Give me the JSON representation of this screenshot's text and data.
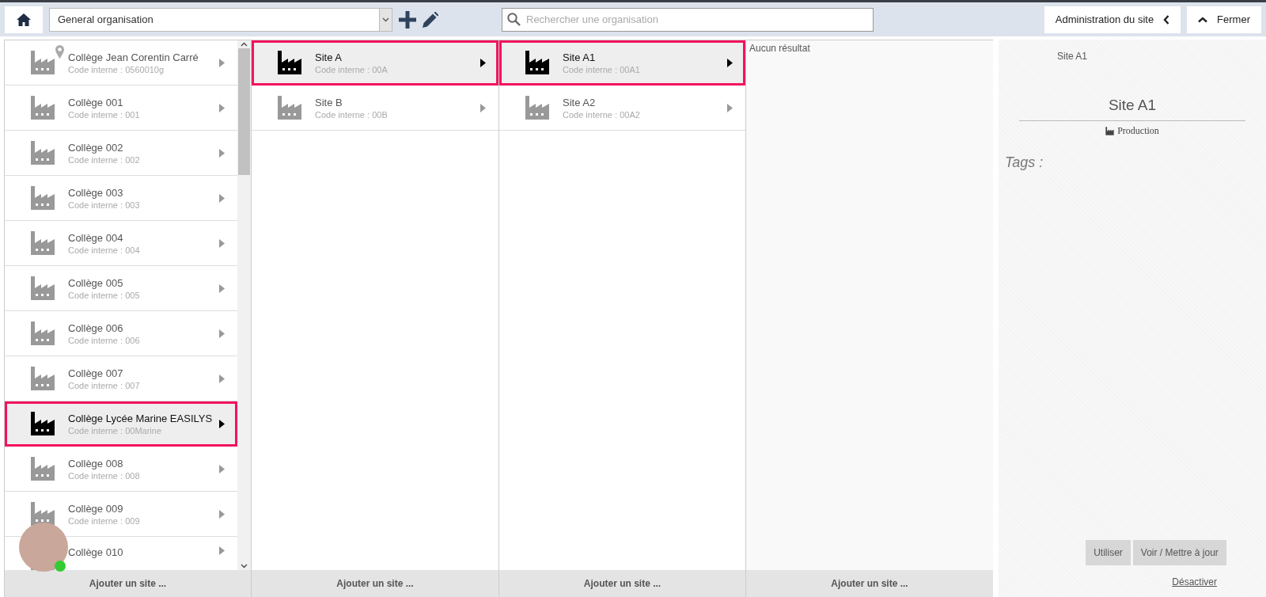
{
  "toolbar": {
    "organisation": "General organisation",
    "search_placeholder": "Rechercher une organisation",
    "admin_button": "Administration du site",
    "close_button": "Fermer"
  },
  "columns": [
    {
      "footer": "Ajouter un site ...",
      "items": [
        {
          "name": "Collège Jean Corentin Carré",
          "code": "Code interne : 0560010g",
          "selected": false,
          "pinned": true
        },
        {
          "name": "Collège 001",
          "code": "Code interne : 001",
          "selected": false,
          "pinned": false
        },
        {
          "name": "Collège 002",
          "code": "Code interne : 002",
          "selected": false,
          "pinned": false
        },
        {
          "name": "Collège 003",
          "code": "Code interne : 003",
          "selected": false,
          "pinned": false
        },
        {
          "name": "Collège 004",
          "code": "Code interne : 004",
          "selected": false,
          "pinned": false
        },
        {
          "name": "Collège 005",
          "code": "Code interne : 005",
          "selected": false,
          "pinned": false
        },
        {
          "name": "Collège 006",
          "code": "Code interne : 006",
          "selected": false,
          "pinned": false
        },
        {
          "name": "Collège 007",
          "code": "Code interne : 007",
          "selected": false,
          "pinned": false
        },
        {
          "name": "Collège Lycée Marine EASILYS",
          "code": "Code interne : 00Marine",
          "selected": true,
          "pinned": false
        },
        {
          "name": "Collège 008",
          "code": "Code interne : 008",
          "selected": false,
          "pinned": false
        },
        {
          "name": "Collège 009",
          "code": "Code interne : 009",
          "selected": false,
          "pinned": false
        },
        {
          "name": "Collège 010",
          "selected": false,
          "pinned": false
        }
      ]
    },
    {
      "footer": "Ajouter un site ...",
      "items": [
        {
          "name": "Site A",
          "code": "Code interne : 00A",
          "selected": true
        },
        {
          "name": "Site B",
          "code": "Code interne : 00B",
          "selected": false
        }
      ]
    },
    {
      "footer": "Ajouter un site ...",
      "items": [
        {
          "name": "Site A1",
          "code": "Code interne : 00A1",
          "selected": true
        },
        {
          "name": "Site A2",
          "code": "Code interne : 00A2",
          "selected": false
        }
      ]
    },
    {
      "footer": "Ajouter un site ...",
      "message": "Aucun résultat"
    }
  ],
  "detail": {
    "breadcrumb": "Site A1",
    "title": "Site A1",
    "type": "Production",
    "tags_label": "Tags :",
    "buttons": [
      "Utiliser",
      "Voir / Mettre à jour"
    ],
    "link": "Désactiver"
  },
  "chat": {
    "online": true
  }
}
